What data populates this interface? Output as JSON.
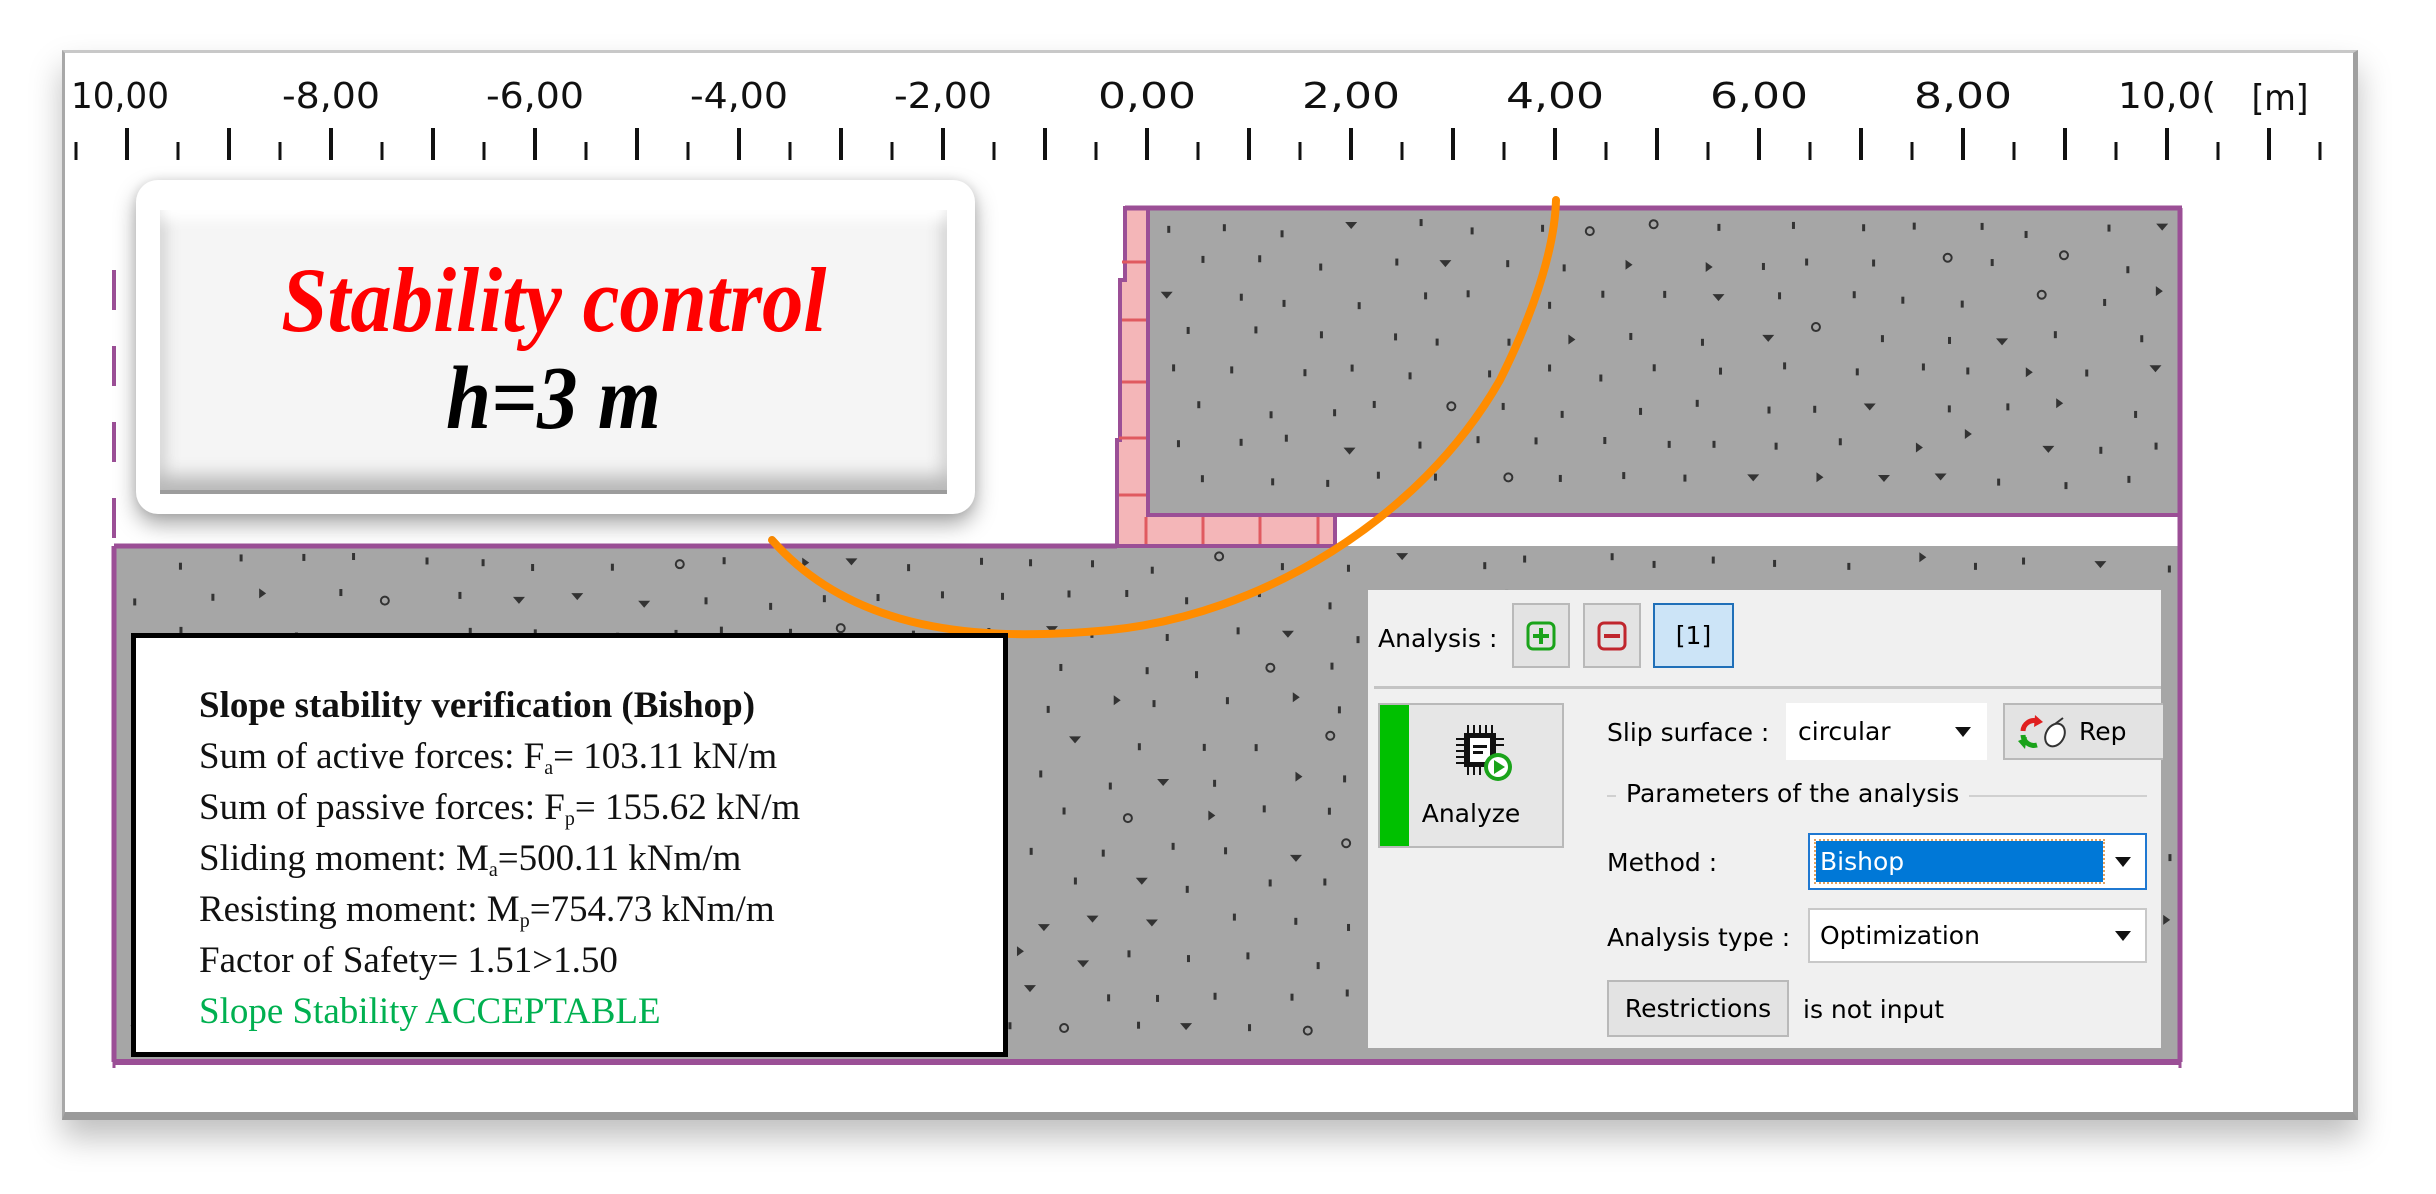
{
  "ruler": {
    "unit_label": "[m]",
    "labels": [
      "10,00",
      "-8,00",
      "-6,00",
      "-4,00",
      "-2,00",
      "0,00",
      "2,00",
      "4,00",
      "6,00",
      "8,00",
      "10,0("
    ],
    "label_values_m": [
      -10,
      -8,
      -6,
      -4,
      -2,
      0,
      2,
      4,
      6,
      8,
      10
    ]
  },
  "title_card": {
    "title": "Stability control",
    "subtitle": "h=3 m"
  },
  "results": {
    "heading": "Slope stability verification (Bishop)",
    "active_forces": {
      "prefix": "Sum of active forces: F",
      "sub": "a",
      "value": "= 103.11 kN/m"
    },
    "passive_forces": {
      "prefix": "Sum of passive forces: F",
      "sub": "p",
      "value": "= 155.62 kN/m"
    },
    "sliding_moment": {
      "prefix": "Sliding moment: M",
      "sub": "a",
      "value": "=500.11 kNm/m"
    },
    "resisting_moment": {
      "prefix": "Resisting moment: M",
      "sub": "p",
      "value": "=754.73 kNm/m"
    },
    "factor_of_safety": "Factor of Safety= 1.51>1.50",
    "verdict": "Slope Stability ACCEPTABLE"
  },
  "analysis_panel": {
    "analysis_label": "Analysis :",
    "add_icon": "plus-square-icon",
    "remove_icon": "minus-square-icon",
    "current_analysis": "[1]",
    "analyze_label": "Analyze",
    "analyze_icon": "chip-play-icon",
    "slip_surface_label": "Slip surface :",
    "slip_surface_value": "circular",
    "replace_button_label": "Rep",
    "replace_icon": "refresh-mouse-icon",
    "parameters_group_label": "Parameters of the analysis",
    "method_label": "Method :",
    "method_value": "Bishop",
    "analysis_type_label": "Analysis type :",
    "analysis_type_value": "Optimization",
    "restrictions_button_label": "Restrictions",
    "restrictions_status": "is not input"
  },
  "colors": {
    "soil_fill": "#a6a6a6",
    "boundary": "#9b4f96",
    "wall_fill": "#f4b6b8",
    "wall_joint": "#e05a60",
    "slip_surface": "#ff8c00",
    "title_red": "#ff0000",
    "verdict_green": "#00b050",
    "analyze_green": "#00c000",
    "selection_blue": "#0078d7"
  }
}
